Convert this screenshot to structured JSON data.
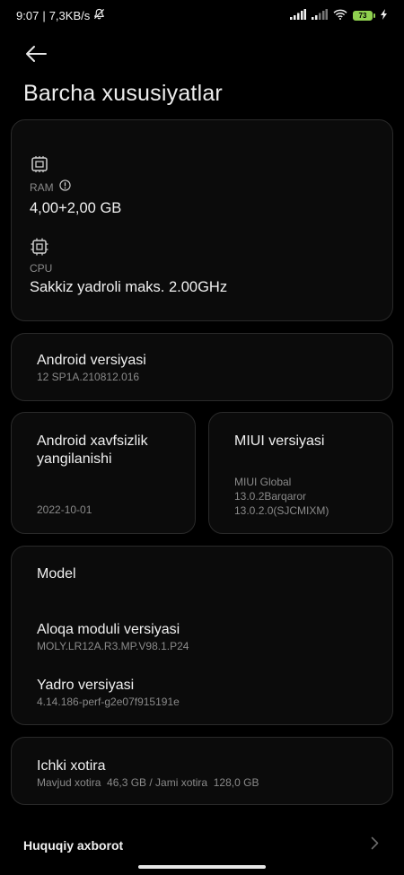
{
  "status": {
    "time": "9:07",
    "separator": "|",
    "speed": "7,3KB/s",
    "battery": "73"
  },
  "header": {
    "title": "Barcha xususiyatlar"
  },
  "specs": {
    "ram_label": "RAM",
    "ram_value": "4,00+2,00 GB",
    "cpu_label": "CPU",
    "cpu_value": "Sakkiz yadroli maks. 2.00GHz"
  },
  "android": {
    "title": "Android versiyasi",
    "value": "12 SP1A.210812.016"
  },
  "security": {
    "title_line1": "Android xavfsizlik",
    "title_line2": "yangilanishi",
    "value": "2022-10-01"
  },
  "miui": {
    "title": "MIUI versiyasi",
    "line1": "MIUI Global",
    "line2": "13.0.2Barqaror",
    "line3": "13.0.2.0(SJCMIXM)"
  },
  "model": {
    "title": "Model",
    "baseband_title": "Aloqa moduli versiyasi",
    "baseband_value": "MOLY.LR12A.R3.MP.V98.1.P24",
    "kernel_title": "Yadro versiyasi",
    "kernel_value": "4.14.186-perf-g2e07f915191e"
  },
  "storage": {
    "title": "Ichki xotira",
    "value": "Mavjud xotira  46,3 GB / Jami xotira  128,0 GB"
  },
  "legal": {
    "label": "Huquqiy axborot"
  }
}
